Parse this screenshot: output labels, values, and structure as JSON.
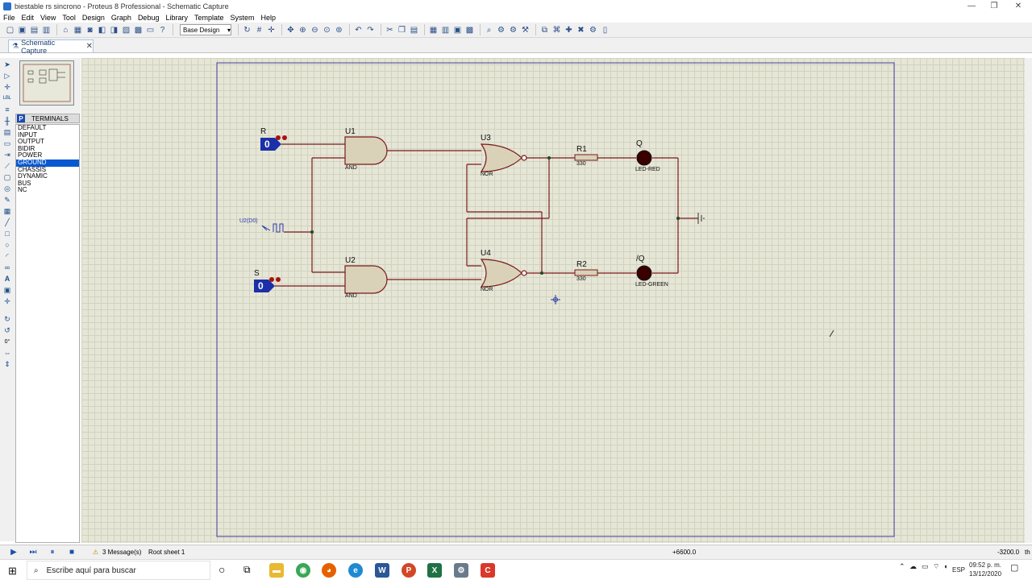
{
  "window": {
    "title": "biestable rs sincrono - Proteus 8 Professional - Schematic Capture",
    "controls": [
      "—",
      "❐",
      "✕"
    ]
  },
  "menu": [
    "File",
    "Edit",
    "View",
    "Tool",
    "Design",
    "Graph",
    "Debug",
    "Library",
    "Template",
    "System",
    "Help"
  ],
  "toolbar": {
    "design_dropdown": "Base Design"
  },
  "tab": {
    "label": "Schematic Capture",
    "close": "✕"
  },
  "side_panel": {
    "mode_button": "P",
    "title": "TERMINALS",
    "items": [
      "DEFAULT",
      "INPUT",
      "OUTPUT",
      "BIDIR",
      "POWER",
      "GROUND",
      "CHASSIS",
      "DYNAMIC",
      "BUS",
      "NC"
    ],
    "selected": "GROUND",
    "rotation": "0°"
  },
  "schematic": {
    "u1": {
      "ref": "U1",
      "type": "AND"
    },
    "u2": {
      "ref": "U2",
      "type": "AND"
    },
    "u3": {
      "ref": "U3",
      "type": "NOR"
    },
    "u4": {
      "ref": "U4",
      "type": "NOR"
    },
    "r1": {
      "ref": "R1",
      "value": "330"
    },
    "r2": {
      "ref": "R2",
      "value": "330"
    },
    "led_q": {
      "net": "Q",
      "type": "LED-RED"
    },
    "led_nq": {
      "net": "/Q",
      "type": "LED-GREEN"
    },
    "input_r": {
      "label": "R",
      "state": "0"
    },
    "input_s": {
      "label": "S",
      "state": "0"
    },
    "clock": {
      "label": "U2(D0)"
    }
  },
  "status": {
    "messages": "3 Message(s)",
    "sheet": "Root sheet 1",
    "coord_x": "+6600.0",
    "coord_y": "-3200.0",
    "unit": "th"
  },
  "taskbar": {
    "search_placeholder": "Escribe aquí para buscar",
    "language": "ESP",
    "time": "09:52 p. m.",
    "date": "13/12/2020"
  },
  "colors": {
    "canvas": "#e6e6d7",
    "wire": "#7a1a1a",
    "component_fill": "#d9d2b8",
    "terminal_blue": "#1b2fa8",
    "led_dark": "#3a0000"
  }
}
